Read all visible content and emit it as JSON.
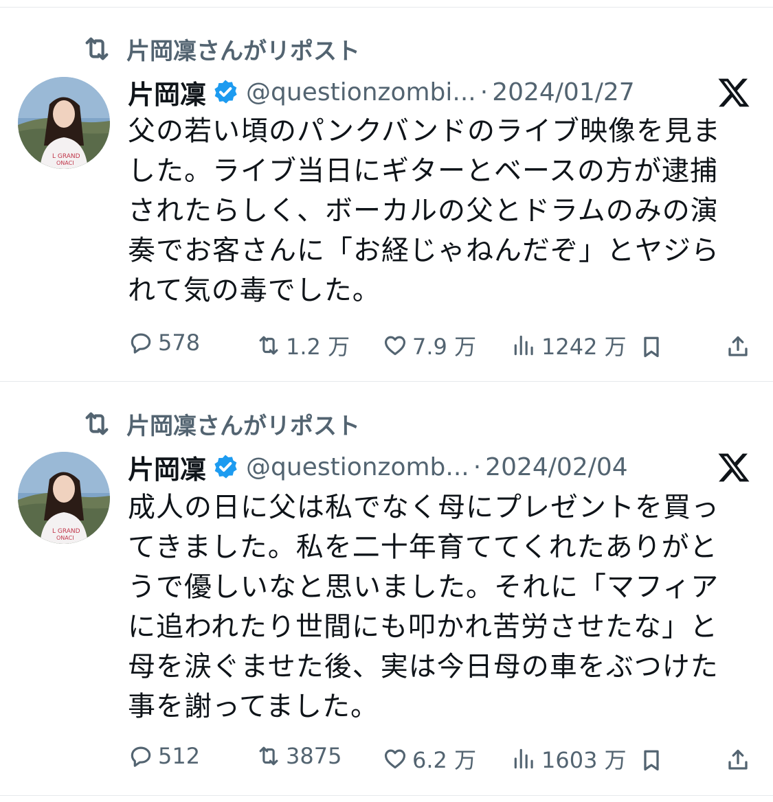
{
  "colors": {
    "text": "#0f1419",
    "muted": "#536471",
    "verified": "#1d9bf0",
    "divider": "#e6e9ec"
  },
  "icons": {
    "repost": "repost-icon",
    "reply": "reply-icon",
    "like": "heart-icon",
    "views": "views-icon",
    "bookmark": "bookmark-icon",
    "share": "share-icon",
    "platform": "x-logo-icon",
    "verified": "verified-badge-icon"
  },
  "tweets": [
    {
      "repost_label": "片岡凜さんがリポスト",
      "author_name": "片岡凜",
      "author_handle": "@questionzombi...",
      "date": "2024/01/27",
      "text_lines": [
        "父の若い頃のパンクバンドのライブ映像を見ま",
        "した。ライブ当日にギターとベースの方が逮捕",
        "されたらしく、ボーカルの父とドラムのみの演",
        "奏でお客さんに「お経じゃねんだぞ」とヤジら",
        "れて気の毒でした。"
      ],
      "replies": "578",
      "reposts": "1.2 万",
      "likes": "7.9 万",
      "views": "1242 万"
    },
    {
      "repost_label": "片岡凜さんがリポスト",
      "author_name": "片岡凜",
      "author_handle": "@questionzomb...",
      "date": "2024/02/04",
      "text_lines": [
        "成人の日に父は私でなく母にプレゼントを買っ",
        "てきました。私を二十年育ててくれたありがと",
        "うで優しいなと思いました。それに「マフィア",
        "に追われたり世間にも叩かれ苦労させたな」と",
        "母を涙ぐませた後、実は今日母の車をぶつけた",
        "事を謝ってました。"
      ],
      "replies": "512",
      "reposts": "3875",
      "likes": "6.2 万",
      "views": "1603 万"
    }
  ]
}
